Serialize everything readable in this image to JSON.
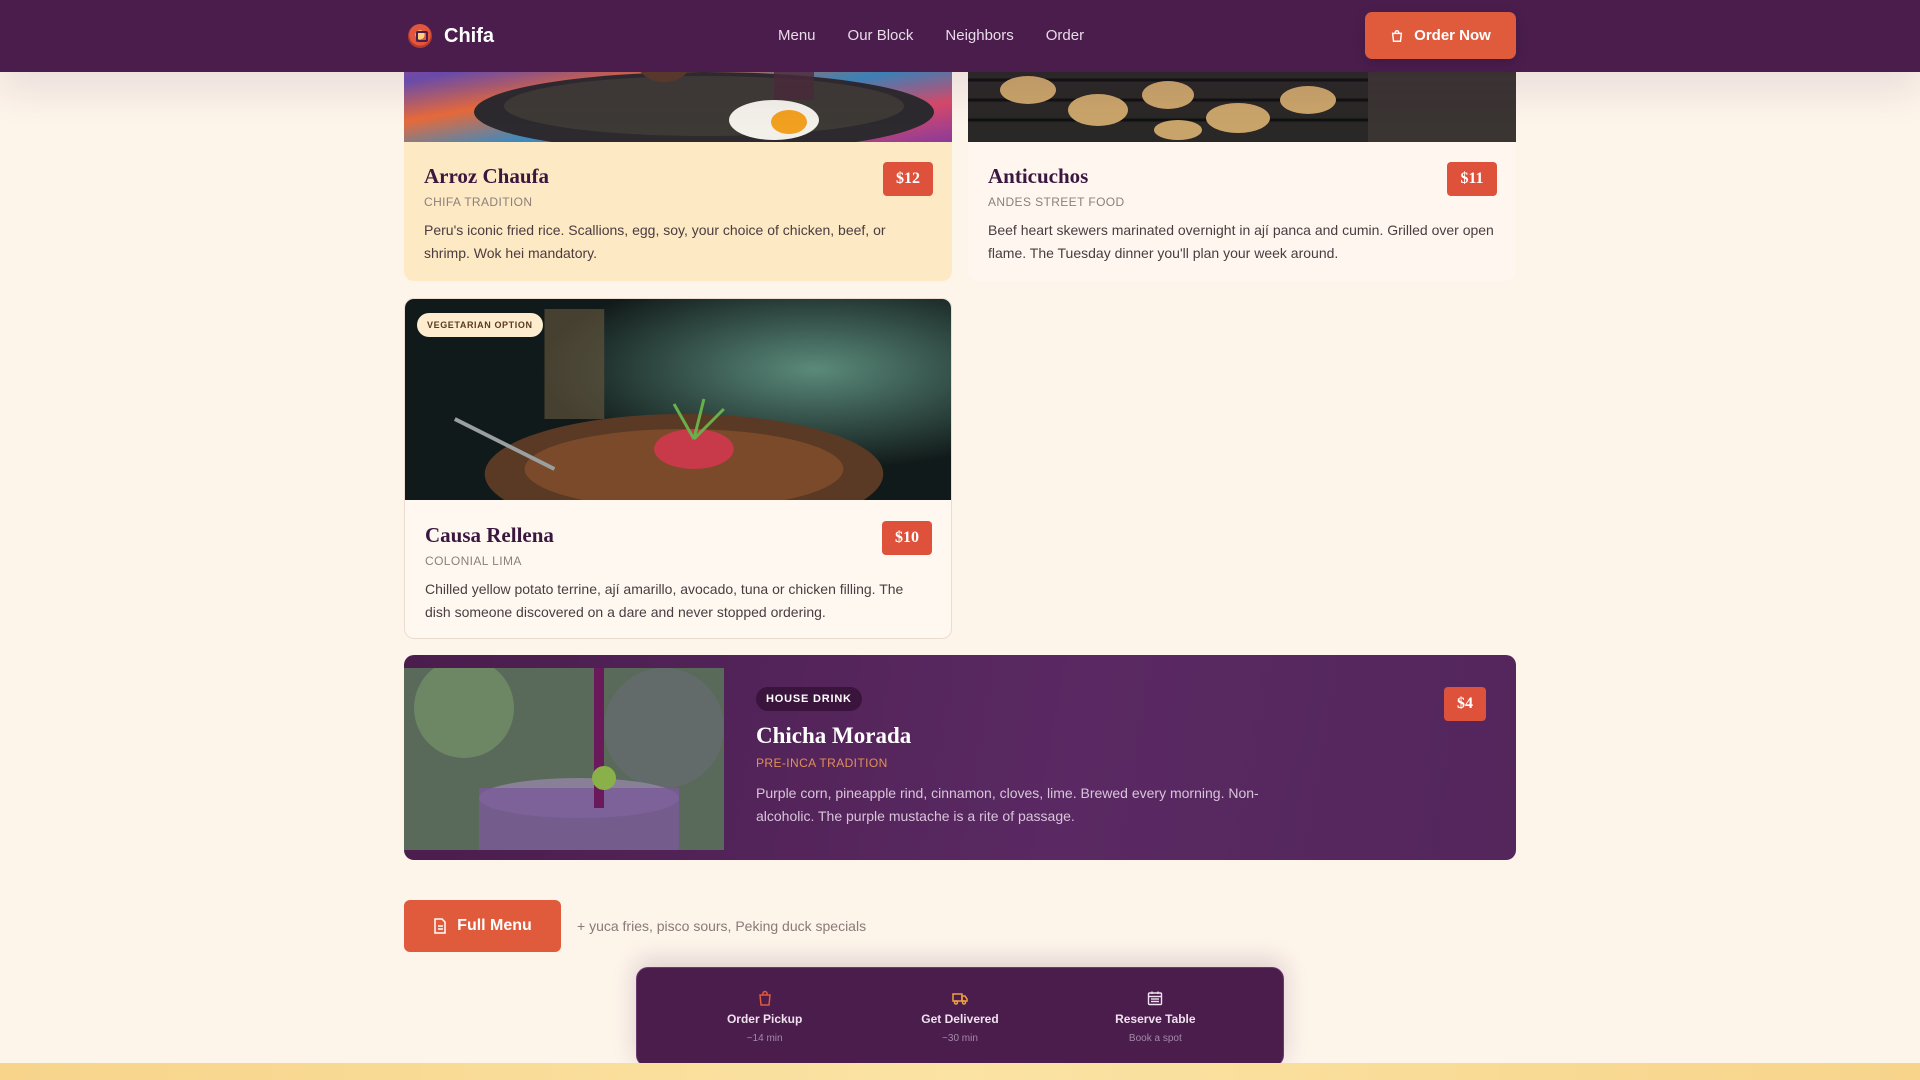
{
  "nav": {
    "brand": "Chifa",
    "links": [
      "Menu",
      "Our Block",
      "Neighbors",
      "Order"
    ],
    "cta": "Order Now"
  },
  "dishes": [
    {
      "title": "Arroz Chaufa",
      "origin": "CHIFA TRADITION",
      "price": "$12",
      "description": "Peru's iconic fried rice. Scallions, egg, soy, your choice of chicken, beef, or shrimp. Wok hei mandatory."
    },
    {
      "title": "Anticuchos",
      "origin": "ANDES STREET FOOD",
      "price": "$11",
      "description": "Beef heart skewers marinated overnight in ají panca and cumin. Grilled over open flame. The Tuesday dinner you'll plan your week around."
    },
    {
      "title": "Causa Rellena",
      "origin": "COLONIAL LIMA",
      "price": "$10",
      "badge": "VEGETARIAN OPTION",
      "description": "Chilled yellow potato terrine, ají amarillo, avocado, tuna or chicken filling. The dish someone discovered on a dare and never stopped ordering."
    }
  ],
  "drink": {
    "badge": "HOUSE DRINK",
    "title": "Chicha Morada",
    "origin": "PRE-INCA TRADITION",
    "price": "$4",
    "description": "Purple corn, pineapple rind, cinnamon, cloves, lime. Brewed every morning. Non-alcoholic. The purple mustache is a rite of passage."
  },
  "full_menu": {
    "label": "Full Menu",
    "note": "+ yuca fries, pisco sours, Peking duck specials"
  },
  "dock": [
    {
      "label": "Order Pickup",
      "sub": "~14 min",
      "icon": "shopping-bag-icon"
    },
    {
      "label": "Get Delivered",
      "sub": "~30 min",
      "icon": "delivery-truck-icon"
    },
    {
      "label": "Reserve Table",
      "sub": "Book a spot",
      "icon": "calendar-icon"
    }
  ],
  "colors": {
    "nav_bg": "#4a1d4d",
    "accent": "#e05a3c",
    "page_bg": "#fdf4ea",
    "highlight_card": "#fde9c4"
  }
}
